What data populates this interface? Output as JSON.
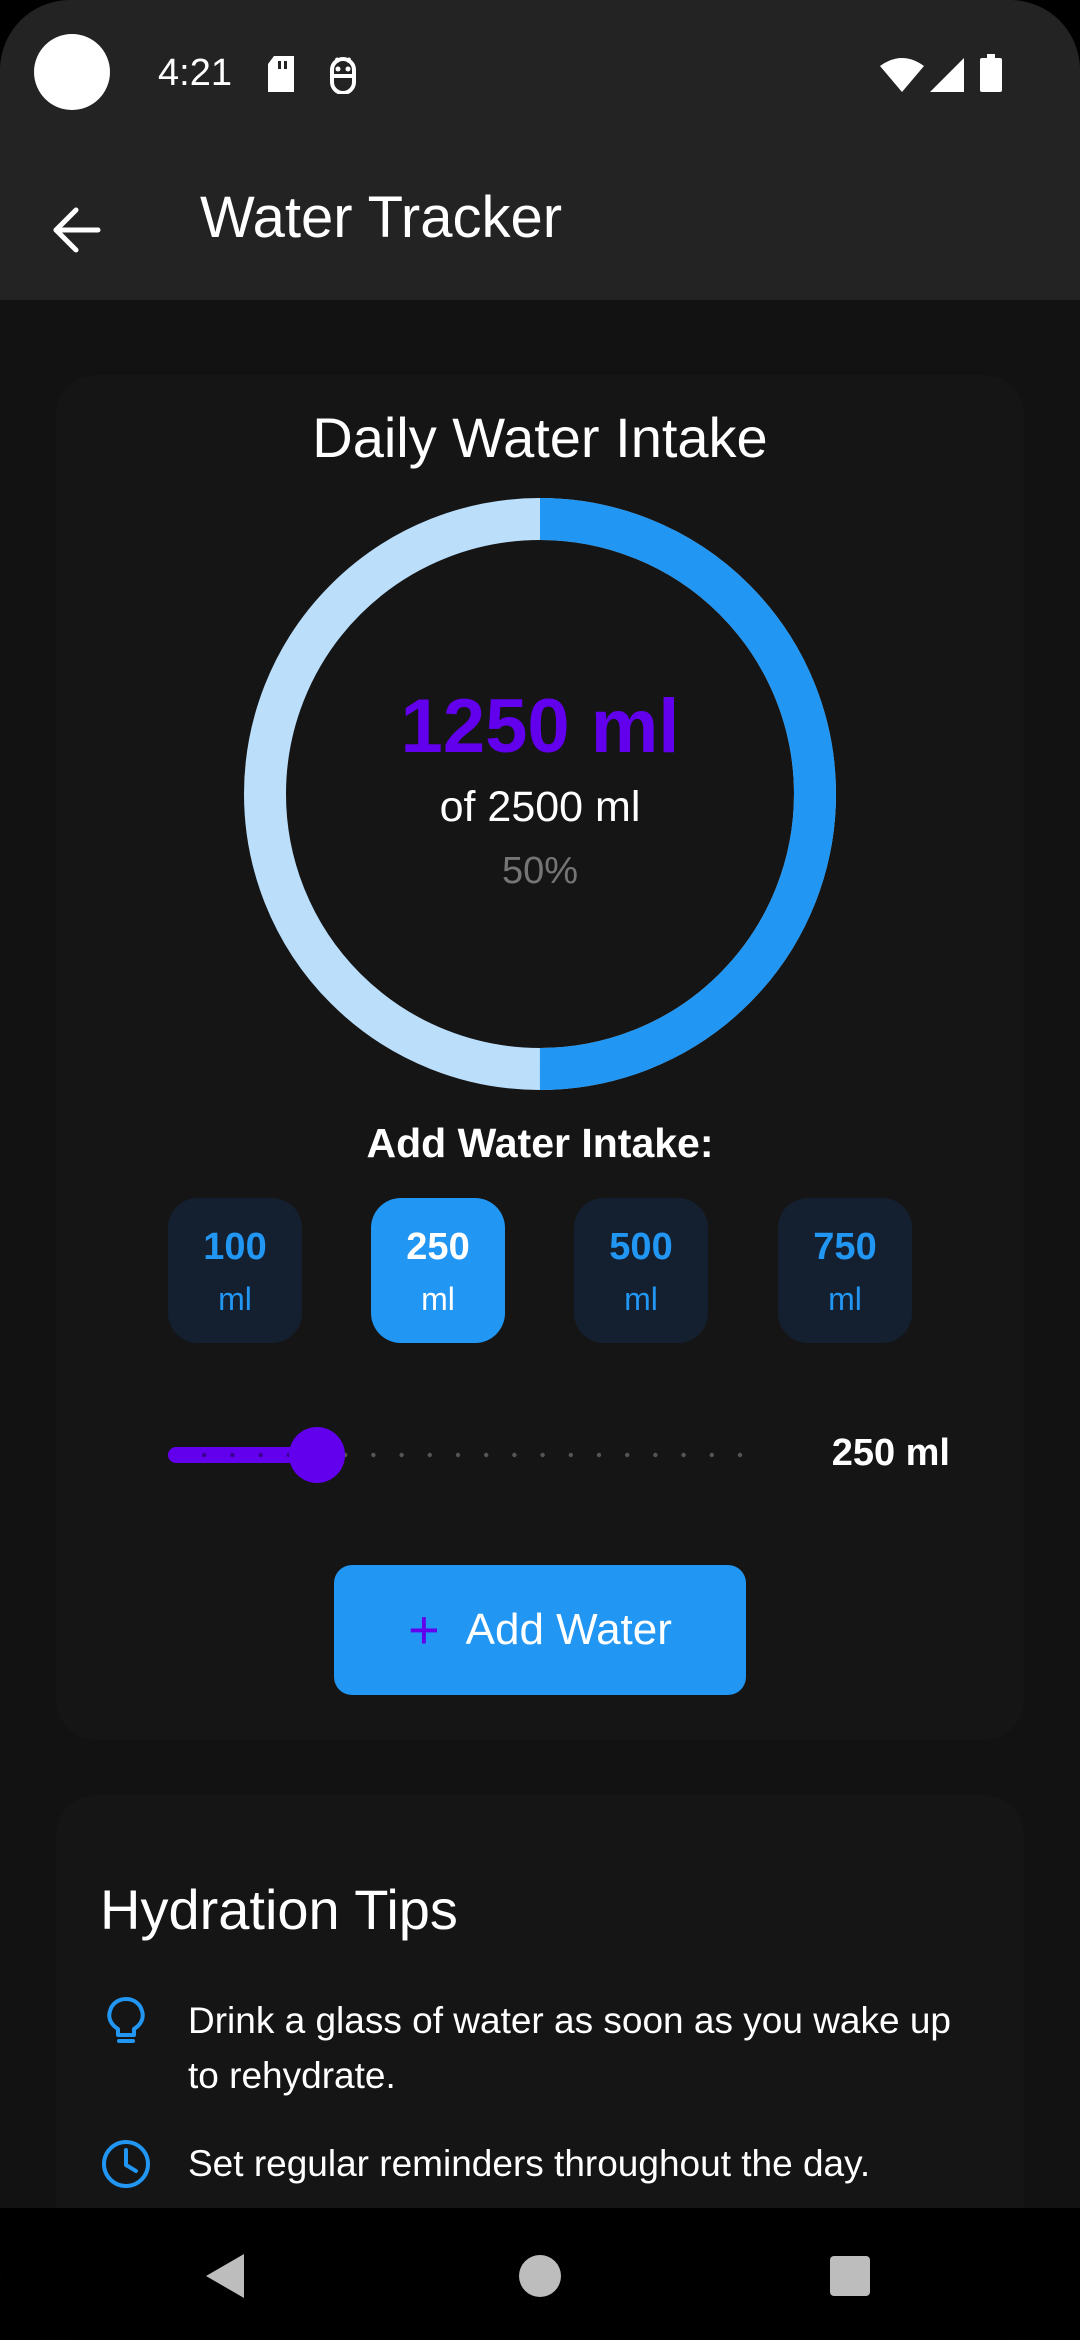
{
  "status_bar": {
    "time": "4:21",
    "icons": [
      "sd-card-icon",
      "android-debug-icon",
      "wifi-icon",
      "signal-icon",
      "battery-icon"
    ]
  },
  "app_bar": {
    "title": "Water Tracker",
    "back_icon": "arrow-back-icon"
  },
  "intake": {
    "title": "Daily Water Intake",
    "current": "1250 ml",
    "goal": "of 2500 ml",
    "percent_text": "50%",
    "progress": 0.5,
    "add_label": "Add Water Intake:",
    "options": [
      {
        "value": "100",
        "unit": "ml",
        "selected": false
      },
      {
        "value": "250",
        "unit": "ml",
        "selected": true
      },
      {
        "value": "500",
        "unit": "ml",
        "selected": false
      },
      {
        "value": "750",
        "unit": "ml",
        "selected": false
      }
    ],
    "slider": {
      "value": 250,
      "min": 0,
      "max": 1000,
      "label": "250 ml"
    },
    "add_button": {
      "icon": "plus-icon",
      "label": "Add Water"
    }
  },
  "tips": {
    "title": "Hydration Tips",
    "items": [
      {
        "icon": "lightbulb-icon",
        "text": "Drink a glass of water as soon as you wake up to rehydrate."
      },
      {
        "icon": "clock-icon",
        "text": "Set regular reminders throughout the day."
      }
    ]
  },
  "colors": {
    "accent_blue": "#2196f3",
    "ring_track": "#bbdefb",
    "purple": "#6200ee",
    "background": "#121212",
    "app_bar": "#232323"
  },
  "nav_bar": {
    "buttons": [
      "back-triangle-icon",
      "home-circle-icon",
      "recents-square-icon"
    ]
  }
}
